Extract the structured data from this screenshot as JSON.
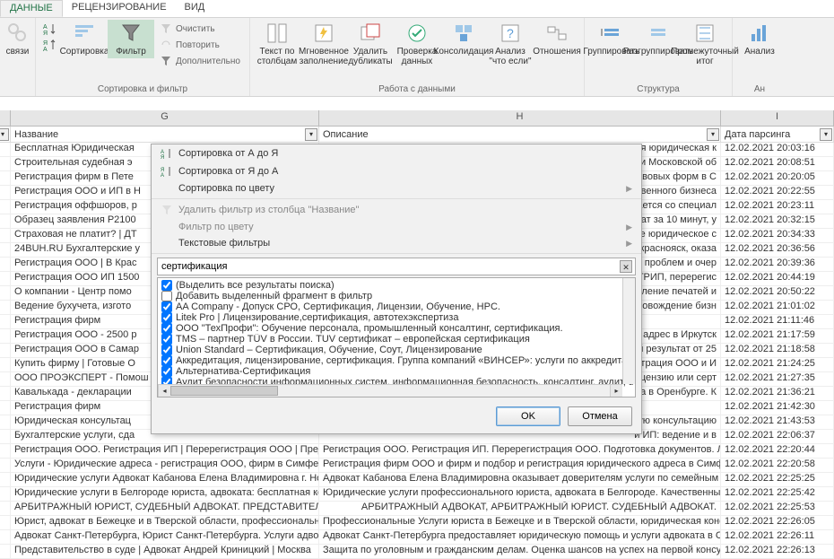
{
  "ribbon": {
    "tabs": [
      "ДАННЫЕ",
      "РЕЦЕНЗИРОВАНИЕ",
      "ВИД"
    ],
    "active_tab": 0,
    "g_links": "связи",
    "g_sort_filter": {
      "sort_az": "Сортировка",
      "filter": "Фильтр",
      "clear": "Очистить",
      "reapply": "Повторить",
      "advanced": "Дополнительно",
      "label": "Сортировка и фильтр"
    },
    "g_data_tools": {
      "text_to_cols": "Текст по столбцам",
      "flash_fill": "Мгновенное заполнение",
      "remove_dup": "Удалить дубликаты",
      "validation": "Проверка данных",
      "consolidate": "Консолидация",
      "whatif": "Анализ \"что если\"",
      "relations": "Отношения",
      "label": "Работа с данными"
    },
    "g_outline": {
      "group": "Группировать",
      "ungroup": "Разгруппировать",
      "subtotal": "Промежуточный итог",
      "label": "Структура"
    },
    "g_analysis": {
      "analysis": "Анализ",
      "label": "Ан"
    }
  },
  "columns": {
    "g": "G",
    "h": "H",
    "i": "I"
  },
  "headers": {
    "name": "Название",
    "desc": "Описание",
    "date": "Дата парсинга"
  },
  "rows": [
    {
      "g": "Бесплатная Юридическая",
      "h": "ая юридическая к",
      "i": "12.02.2021 20:03:16"
    },
    {
      "g": "Строительная судебная э",
      "h": "и Московской об",
      "i": "12.02.2021 20:08:51"
    },
    {
      "g": "Регистрация фирм в Пете",
      "h": "авовых форм в С",
      "i": "12.02.2021 20:20:05"
    },
    {
      "g": "Регистрация ООО и ИП в Н",
      "h": "венного бизнеса",
      "i": "12.02.2021 20:22:55"
    },
    {
      "g": "Регистрация оффшоров, р",
      "h": "ается со специал",
      "i": "12.02.2021 20:23:11"
    },
    {
      "g": "Образец заявления Р2100",
      "h": "ат за 10 минут, у",
      "i": "12.02.2021 20:32:15"
    },
    {
      "g": "Страховая не платит? | ДТ",
      "h": "ое юридическое с",
      "i": "12.02.2021 20:34:33"
    },
    {
      "g": "24BUH.RU Бухгалтерские у",
      "h": "краснояск, оказа",
      "i": "12.02.2021 20:36:56"
    },
    {
      "g": "Регистрация ООО | В Крас",
      "h": "з проблем и очер",
      "i": "12.02.2021 20:39:36"
    },
    {
      "g": "Регистрация ООО ИП 1500",
      "h": "ЕГРИП, перерегис",
      "i": "12.02.2021 20:44:19"
    },
    {
      "g": "О компании - Центр помо",
      "h": "вление печатей и",
      "i": "12.02.2021 20:50:22"
    },
    {
      "g": "Ведение бухучета, изгото",
      "h": "ровождение бизн",
      "i": "12.02.2021 21:01:02"
    },
    {
      "g": "Регистрация фирм",
      "h": "",
      "i": "12.02.2021 21:11:46"
    },
    {
      "g": "Регистрация ООО - 2500 р",
      "h": "й адрес в Иркутск",
      "i": "12.02.2021 21:17:59"
    },
    {
      "g": "Регистрация ООО в Самар",
      "h": "й результат от 25",
      "i": "12.02.2021 21:18:58"
    },
    {
      "g": "Купить фирму | Готовые О",
      "h": "истрация ООО и И",
      "i": "12.02.2021 21:24:25"
    },
    {
      "g": "ООО ПРОЭКСПЕРТ - Помош",
      "h": "цензию или серт",
      "i": "12.02.2021 21:27:35"
    },
    {
      "g": "Кавалькада - декларации",
      "h": "ела в Оренбурге. К",
      "i": "12.02.2021 21:36:21"
    },
    {
      "g": "Регистрация фирм",
      "h": "",
      "i": "12.02.2021 21:42:30"
    },
    {
      "g": "Юридическая консультац",
      "h": "ую консультацию",
      "i": "12.02.2021 21:43:53"
    },
    {
      "g": "Бухгалтерские услуги, сда",
      "h": "и ИП: ведение и в",
      "i": "12.02.2021 22:06:37"
    },
    {
      "g": "Регистрация ООО. Регистрация ИП | Перерегистрация ООО | Предс",
      "h": "Регистрация ООО. Регистрация ИП. Перерегистрация ООО. Подготовка документов. Ли",
      "i": "12.02.2021 22:20:44"
    },
    {
      "g": "Услуги - Юридические адреса - регистрация ООО, фирм в Симферо",
      "h": "Регистрация фирм ООО и фирм и подбор и регистрация юридического адреса в Симферо",
      "i": "12.02.2021 22:20:58"
    },
    {
      "g": "Юридические услуги Адвокат Кабанова Елена Владимировна г. Ноги",
      "h": "Адвокат Кабанова Елена Владимировна оказывает доверителям услуги по семейным сп",
      "i": "12.02.2021 22:25:25"
    },
    {
      "g": "Юридические услуги в Белгороде юриста, адвоката: бесплатная кон",
      "h": "Юридические услуги профессионального юриста, адвоката в Белгороде. Качественные",
      "i": "12.02.2021 22:25:42"
    },
    {
      "g": "АРБИТРАЖНЫЙ ЮРИСТ, СУДЕБНЫЙ АДВОКАТ. ПРЕДСТАВИТЕЛЬСТВО",
      "h": "АРБИТРАЖНЫЙ АДВОКАТ, АРБИТРАЖНЫЙ ЮРИСТ. СУДЕБНЫЙ АДВОКАТ.",
      "i": "12.02.2021 22:25:53"
    },
    {
      "g": "Юрист, адвокат в Бежецке и в Тверской области, профессиональная",
      "h": "Профессиональные Услуги юриста в Бежецке и в Тверской области, юридическая консу",
      "i": "12.02.2021 22:26:05"
    },
    {
      "g": "Адвокат Санкт-Петербурга, Юрист Санкт-Петербурга. Услуги адвока",
      "h": "Адвокат Санкт-Петербурга предоставляет юридическую помощь и услуги адвоката в Са",
      "i": "12.02.2021 22:26:11"
    },
    {
      "g": "Представительство в суде | Адвокат Андрей Криницкий | Москва",
      "h": "Защита по уголовным и гражданским делам. Оценка шансов на успех на первой консул",
      "i": "12.02.2021 22:26:13"
    }
  ],
  "filter_popup": {
    "sort_az": "Сортировка от А до Я",
    "sort_za": "Сортировка от Я до А",
    "sort_color": "Сортировка по цвету",
    "clear_filter": "Удалить фильтр из столбца \"Название\"",
    "filter_color": "Фильтр по цвету",
    "text_filters": "Текстовые фильтры",
    "search_value": "сертификация",
    "items": [
      {
        "checked": true,
        "label": "(Выделить все результаты поиска)"
      },
      {
        "checked": false,
        "label": "Добавить выделенный фрагмент в фильтр"
      },
      {
        "checked": true,
        "label": "AA Company - Допуск СРО, Сертификация, Лицензии, Обучение, HPC."
      },
      {
        "checked": true,
        "label": "Litek Pro | Лицензирование,сертификация, автотехэкспертиза"
      },
      {
        "checked": true,
        "label": "ООО \"ТехПрофи\": Обучение персонала, промышленный консалтинг, сертификация."
      },
      {
        "checked": true,
        "label": "TMS – партнер TÜV в России. TUV сертификат – европейская сертификация"
      },
      {
        "checked": true,
        "label": "Union Standard – Сертификация, Обучение, Соут, Лицензирование"
      },
      {
        "checked": true,
        "label": "Аккредитация, лицензирование, сертификация. Группа компаний «ВИНСЕР»: услуги по аккредитации, лицензирован"
      },
      {
        "checked": true,
        "label": "Альтернатива-Сертификация"
      },
      {
        "checked": true,
        "label": "Аудит безопасности информационных систем, информационная безопасность, консалтинг, аудит, анализ и оценка и"
      }
    ],
    "ok": "OK",
    "cancel": "Отмена"
  }
}
